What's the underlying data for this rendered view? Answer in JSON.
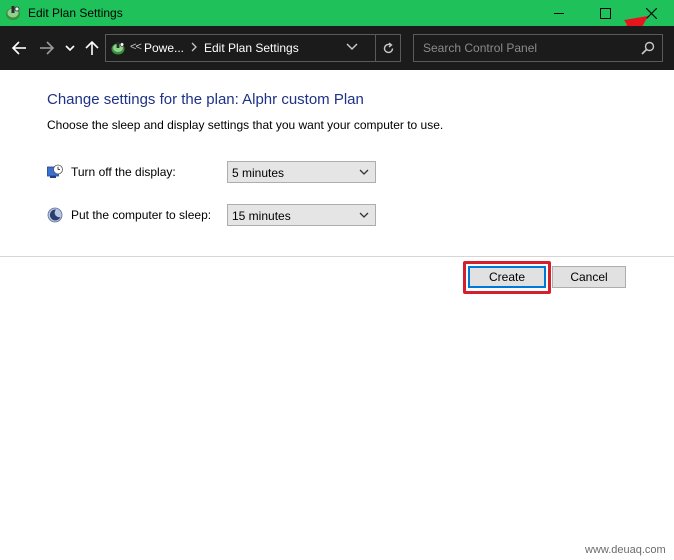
{
  "window": {
    "title": "Edit Plan Settings",
    "titlebar_color": "#1fc25a",
    "icon": "power-options-icon"
  },
  "address_bar": {
    "overflow_chevron": "<<",
    "crumbs": [
      "Powe...",
      "Edit Plan Settings"
    ],
    "search_placeholder": "Search Control Panel"
  },
  "content": {
    "heading": "Change settings for the plan: Alphr custom Plan",
    "description": "Choose the sleep and display settings that you want your computer to use.",
    "settings": [
      {
        "label": "Turn off the display:",
        "value": "5 minutes",
        "icon": "display-timer-icon"
      },
      {
        "label": "Put the computer to sleep:",
        "value": "15 minutes",
        "icon": "sleep-moon-icon"
      }
    ]
  },
  "buttons": {
    "create": "Create",
    "cancel": "Cancel"
  },
  "annotations": {
    "highlight_color": "#d4202c",
    "arrow_color": "#e8141e"
  },
  "watermark": "www.deuaq.com",
  "colors": {
    "heading": "#1e3287",
    "focus_border": "#0078d7"
  }
}
